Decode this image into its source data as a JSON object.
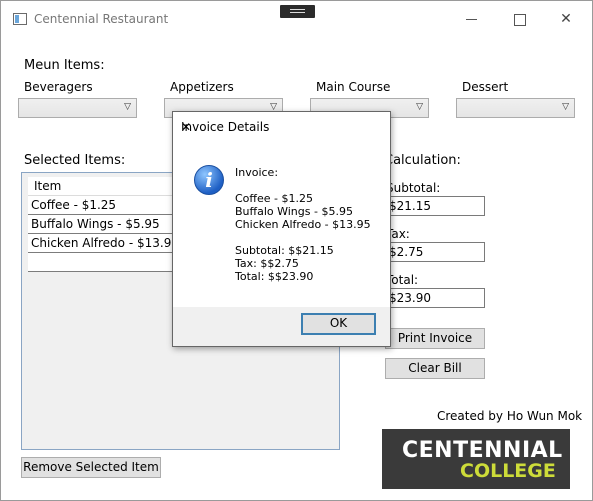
{
  "window": {
    "title": "Centennial Restaurant",
    "minimize_icon": "minimize-icon",
    "maximize_icon": "maximize-icon",
    "close_icon": "close-icon"
  },
  "menu": {
    "heading": "Meun Items:",
    "categories": [
      {
        "label": "Beveragers",
        "selected": ""
      },
      {
        "label": "Appetizers",
        "selected": ""
      },
      {
        "label": "Main Course",
        "selected": ""
      },
      {
        "label": "Dessert",
        "selected": ""
      }
    ]
  },
  "selected": {
    "heading": "Selected Items:",
    "column_header": "Item",
    "items": [
      "Coffee - $1.25",
      "Buffalo Wings - $5.95",
      "Chicken Alfredo - $13.95",
      ""
    ],
    "remove_button": "Remove Selected Item"
  },
  "calculation": {
    "heading": "Calculation:",
    "subtotal_label": "Subtotal:",
    "subtotal_value": "$21.15",
    "tax_label": "Tax:",
    "tax_value": "$2.75",
    "total_label": "Total:",
    "total_value": "$23.90",
    "print_button": "Print Invoice",
    "clear_button": "Clear Bill"
  },
  "footer": {
    "credit": "Created by Ho Wun Mok",
    "logo_line1": "CENTENNIAL",
    "logo_line2": "COLLEGE"
  },
  "dialog": {
    "title": "Invoice Details",
    "icon": "information-icon",
    "lines": [
      "Invoice:",
      "Coffee - $1.25",
      "Buffalo Wings - $5.95",
      "Chicken Alfredo - $13.95",
      "Subtotal: $$21.15",
      "Tax: $$2.75",
      "Total: $$23.90"
    ],
    "ok_button": "OK"
  },
  "colors": {
    "logo_bg": "#3a3a3a",
    "logo_accent": "#cddc39",
    "ok_border": "#3c7fb1"
  }
}
